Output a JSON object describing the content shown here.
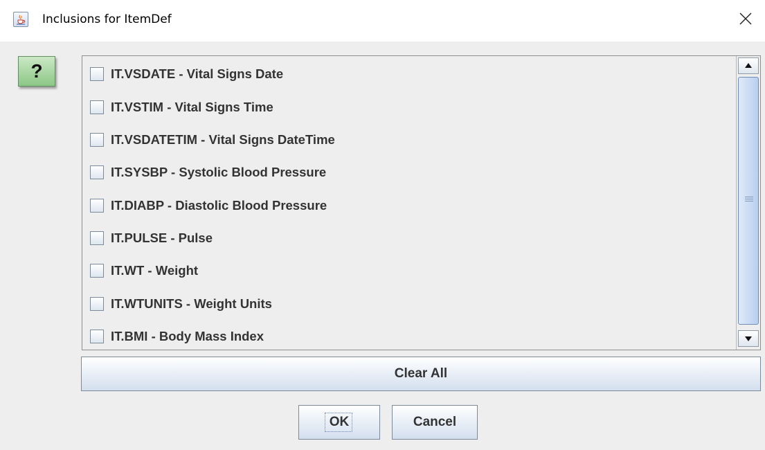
{
  "window": {
    "title": "Inclusions for ItemDef",
    "app_icon": "java-cup-icon",
    "close_icon": "close-icon"
  },
  "help_button": {
    "label": "?",
    "color": "#9fd49a"
  },
  "items": [
    {
      "label": "IT.VSDATE - Vital Signs Date",
      "checked": false
    },
    {
      "label": "IT.VSTIM - Vital Signs Time",
      "checked": false
    },
    {
      "label": "IT.VSDATETIM - Vital Signs DateTime",
      "checked": false
    },
    {
      "label": "IT.SYSBP - Systolic Blood Pressure",
      "checked": false
    },
    {
      "label": "IT.DIABP - Diastolic Blood Pressure",
      "checked": false
    },
    {
      "label": "IT.PULSE - Pulse",
      "checked": false
    },
    {
      "label": "IT.WT - Weight",
      "checked": false
    },
    {
      "label": "IT.WTUNITS - Weight Units",
      "checked": false
    },
    {
      "label": "IT.BMI - Body Mass Index",
      "checked": false
    }
  ],
  "buttons": {
    "clear_all": "Clear All",
    "ok": "OK",
    "cancel": "Cancel"
  }
}
